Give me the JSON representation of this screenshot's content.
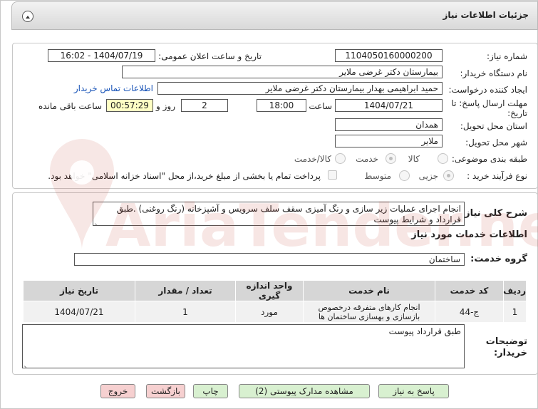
{
  "window": {
    "title": "جزئیات اطلاعات نیاز"
  },
  "fields": {
    "need_number": {
      "label": "شماره نیاز:",
      "value": "1104050160000200"
    },
    "announce_datetime": {
      "label": "تاریخ و ساعت اعلان عمومی:",
      "value": "1404/07/19 - 16:02"
    },
    "buyer": {
      "label": "نام دستگاه خریدار:",
      "value": "بیمارستان دکتر غرضی ملایر"
    },
    "requester": {
      "label": "ایجاد کننده درخواست:",
      "value": "حمید ابراهیمی بهدار بیمارستان دکتر غرضی ملایر",
      "contact_link": "اطلاعات تماس خریدار"
    },
    "deadline": {
      "label_line1": "مهلت ارسال پاسخ: تا",
      "label_line2": "تاریخ:",
      "date": "1404/07/21",
      "time_label": "ساعت",
      "time": "18:00",
      "days": "2",
      "days_label": "روز و",
      "remaining": "00:57:29",
      "remaining_label": "ساعت باقی مانده"
    },
    "province": {
      "label": "استان محل تحویل:",
      "value": "همدان"
    },
    "city": {
      "label": "شهر محل تحویل:",
      "value": "ملایر"
    },
    "category": {
      "label": "طبقه بندی موضوعی:",
      "options": [
        "کالا",
        "خدمت",
        "کالا/خدمت"
      ],
      "selected": "خدمت"
    },
    "purchase_type": {
      "label": "نوع فرآیند خرید :",
      "options": [
        "جزیی",
        "متوسط"
      ],
      "selected": "جزیی",
      "treasury_note": "پرداخت تمام یا بخشی از مبلغ خرید،از محل \"اسناد خزانه اسلامی\" خواهد بود."
    }
  },
  "description": {
    "label": "شرح کلی نیاز:",
    "text": "انجام اجرای عملیات زیر سازی و رنگ آمیزی سقف سلف سرویس و آشپزخانه (رنگ روغنی) .طبق قرارداد و شرایط پیوست"
  },
  "services": {
    "heading": "اطلاعات خدمات مورد نیاز",
    "group_label": "گروه خدمت:",
    "group_value": "ساختمان",
    "columns": [
      "ردیف",
      "کد خدمت",
      "نام خدمت",
      "واحد اندازه گیری",
      "تعداد / مقدار",
      "تاریخ نیاز"
    ],
    "rows": [
      {
        "row": "1",
        "code": "ج-44",
        "name": "انجام کارهای متفرقه درخصوص بازسازی و بهسازی ساختمان ها",
        "unit": "مورد",
        "qty": "1",
        "date": "1404/07/21"
      }
    ]
  },
  "buyer_notes": {
    "label_line1": "توضیحات",
    "label_line2": "خریدار:",
    "text": "طبق قرارداد پیوست"
  },
  "buttons": {
    "reply": "پاسخ به نیاز",
    "attachments": "مشاهده مدارک پیوستی (2)",
    "print": "چاپ",
    "back": "بازگشت",
    "exit": "خروج"
  },
  "watermark": {
    "text": "AriaTender.net"
  },
  "colors": {
    "link": "#1a55b8",
    "button_green": "#d8f0d0",
    "button_red": "#f6d0d0",
    "remaining_bg": "#ffffc4"
  }
}
